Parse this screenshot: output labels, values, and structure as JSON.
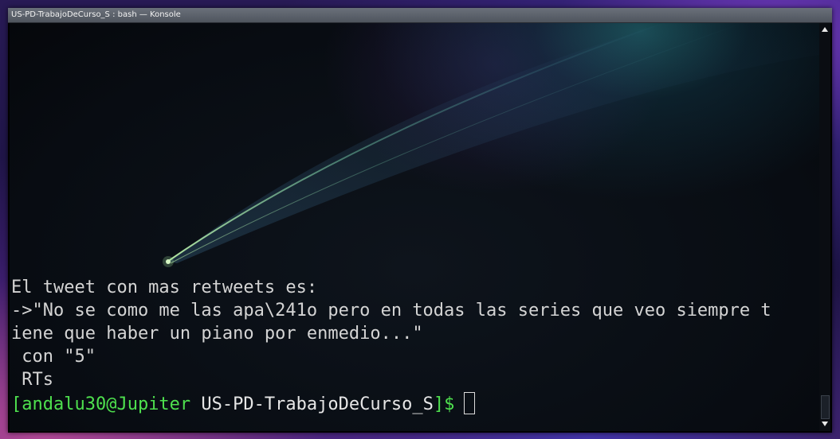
{
  "window": {
    "title": "US-PD-TrabajoDeCurso_S : bash — Konsole"
  },
  "terminal": {
    "output_lines": [
      "El tweet con mas retweets es:",
      "->\"No se como me las apa\\241o pero en todas las series que veo siempre t",
      "iene que haber un piano por enmedio...\"",
      " con \"5\"",
      " RTs"
    ],
    "prompt": {
      "open_bracket": "[",
      "user_host": "andalu30@Jupiter",
      "cwd": "US-PD-TrabajoDeCurso_S",
      "close": "]$"
    }
  },
  "colors": {
    "prompt_green": "#4ee04e",
    "text_gray": "#d4d4d4",
    "background": "#080c12"
  },
  "icons": {
    "scroll_up": "triangle-up",
    "scroll_down": "triangle-down"
  }
}
